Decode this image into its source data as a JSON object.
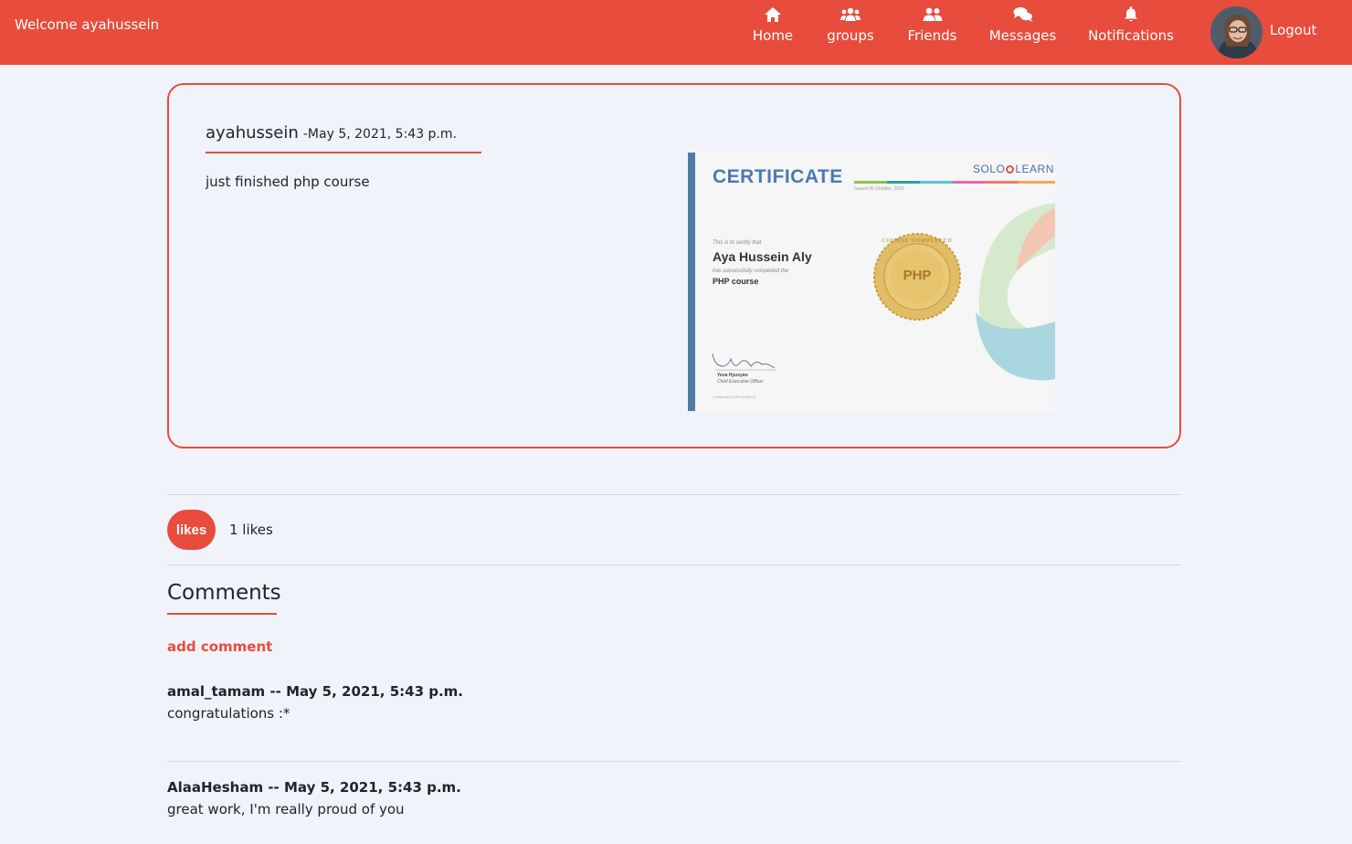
{
  "navbar": {
    "welcome": "Welcome ayahussein",
    "items": [
      {
        "label": "Home",
        "icon": "home-icon"
      },
      {
        "label": "groups",
        "icon": "groups-icon"
      },
      {
        "label": "Friends",
        "icon": "friends-icon"
      },
      {
        "label": "Messages",
        "icon": "messages-icon"
      },
      {
        "label": "Notifications",
        "icon": "bell-icon"
      }
    ],
    "logout": "Logout",
    "color": "#e74c3c"
  },
  "post": {
    "author": "ayahussein",
    "date": "-May 5, 2021, 5:43 p.m.",
    "text": "just finished php course",
    "certificate": {
      "title": "CERTIFICATE",
      "brand_solo": "SOLO",
      "brand_learn": "LEARN",
      "issued": "Issued 06 October, 2020",
      "certify_line": "This is to certify that",
      "name": "Aya Hussein Aly",
      "completed_line": "has successfully completed the",
      "course": "PHP course",
      "seal_text": "PHP",
      "seal_ring": "COURSE COMPLETED",
      "signer": "Yeva Hyusyan",
      "signer_title": "Chief Executive Officer",
      "cert_id": "Certificate #1059-5768870"
    }
  },
  "likes": {
    "button": "likes",
    "count_text": "1 likes"
  },
  "comments": {
    "title": "Comments",
    "add_label": "add comment",
    "items": [
      {
        "meta": "amal_tamam -- May 5, 2021, 5:43 p.m.",
        "body": "congratulations :*"
      },
      {
        "meta": "AlaaHesham -- May 5, 2021, 5:43 p.m.",
        "body": "great work, I'm really proud of you"
      }
    ]
  }
}
